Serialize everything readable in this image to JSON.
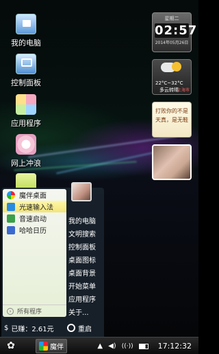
{
  "desktop_icons": [
    {
      "label": "我的电脑",
      "icon": "computer-icon"
    },
    {
      "label": "控制面板",
      "icon": "control-panel-icon"
    },
    {
      "label": "应用程序",
      "icon": "apps-icon"
    },
    {
      "label": "网上冲浪",
      "icon": "browser-icon"
    }
  ],
  "widgets": {
    "clock": {
      "weekday": "星期二",
      "time": "02:57",
      "date": "2014年05月26日"
    },
    "weather": {
      "temp": "22°C~32°C",
      "condition": "多云转晴",
      "city": "上海市"
    },
    "note": {
      "line1": "打败你的不是",
      "line2": "天真，是无鞋"
    }
  },
  "start_menu": {
    "apps": [
      {
        "label": "魔伴桌面",
        "icon": "moban-icon",
        "color": "#e23a3a"
      },
      {
        "label": "光速输入法",
        "icon": "input-method-icon",
        "color": "#2a8be0"
      },
      {
        "label": "音速启动",
        "icon": "launcher-icon",
        "color": "#3aa04a"
      },
      {
        "label": "哈哈日历",
        "icon": "calendar-icon",
        "color": "#3a6ad0"
      }
    ],
    "all_programs": "所有程序",
    "right_items": [
      "我的电脑",
      "文明搜索",
      "控制面板",
      "桌面图标",
      "桌面背景",
      "开始菜单",
      "应用程序",
      "关于..."
    ],
    "earned": "已赚：2.61元",
    "restart": "重启"
  },
  "taskbar": {
    "start_icon": "start-flower-icon",
    "task_label": "魔伴",
    "tray_arrow": "▲",
    "time": "17:12:32"
  }
}
